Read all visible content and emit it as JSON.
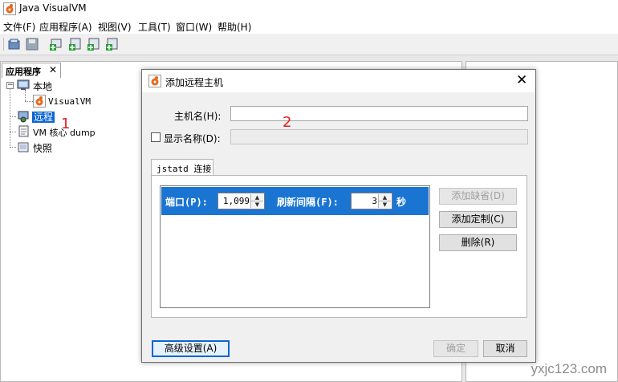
{
  "window": {
    "title": "Java VisualVM"
  },
  "menu": [
    "文件(F)",
    "应用程序(A)",
    "视图(V)",
    "工具(T)",
    "窗口(W)",
    "帮助(H)"
  ],
  "left_panel": {
    "tab_label": "应用程序",
    "tab_close": "✕",
    "tree": {
      "local": "本地",
      "visualvm": "VisualVM",
      "remote": "远程",
      "core_dump": "VM 核心 dump",
      "snapshot": "快照"
    },
    "annotation_1": "1"
  },
  "dialog": {
    "title": "添加远程主机",
    "close_glyph": "✕",
    "hostname_label": "主机名(H):",
    "hostname_value": "",
    "annotation_2": "2",
    "display_name_label": "显示名称(D):",
    "display_name_value": "",
    "display_name_checked": false,
    "tab_label": "jstatd 连接",
    "row": {
      "port_label": "端口(P):",
      "port_value": "1,099",
      "interval_label": "刷新间隔(F):",
      "interval_value": "3",
      "interval_unit": "秒"
    },
    "buttons": {
      "add_default": "添加缺省(D)",
      "add_custom": "添加定制(C)",
      "delete": "删除(R)",
      "advanced": "高级设置(A)",
      "ok": "确定",
      "cancel": "取消"
    }
  },
  "watermark": "yxjc123.com",
  "colors": {
    "selection": "#1a75d2",
    "annotation": "#e0201c"
  }
}
